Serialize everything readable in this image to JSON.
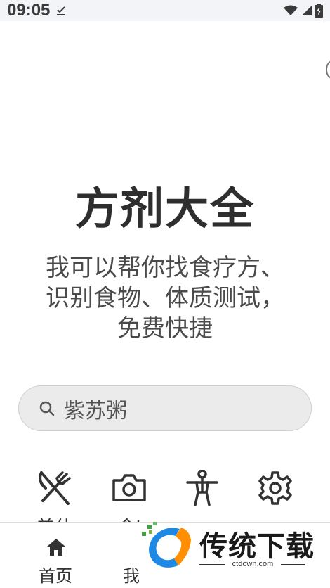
{
  "status_bar": {
    "time": "09:05",
    "icons": [
      "download-done-icon",
      "wifi-icon",
      "signal-icon",
      "battery-icon"
    ]
  },
  "main": {
    "title": "方剂大全",
    "subtitle": "我可以帮你找食疗方、识别食物、体质测试，免费快捷",
    "search": {
      "value": "紫苏粥",
      "icon": "search-icon"
    }
  },
  "features": [
    {
      "icon": "fork-knife-icon",
      "label": "美什"
    },
    {
      "icon": "camera-icon",
      "label": "食i"
    },
    {
      "icon": "body-icon",
      "label": ""
    },
    {
      "icon": "gear-icon",
      "label": ""
    }
  ],
  "bottom_nav": {
    "items": [
      {
        "icon": "home-icon",
        "label": "首页"
      },
      {
        "icon": "",
        "label": "我"
      }
    ]
  },
  "watermark": {
    "title": "传统下载",
    "site": "ctdown.com",
    "colors": {
      "blue": "#1e88e5",
      "orange": "#ff8f00",
      "green": "#43a047"
    }
  }
}
